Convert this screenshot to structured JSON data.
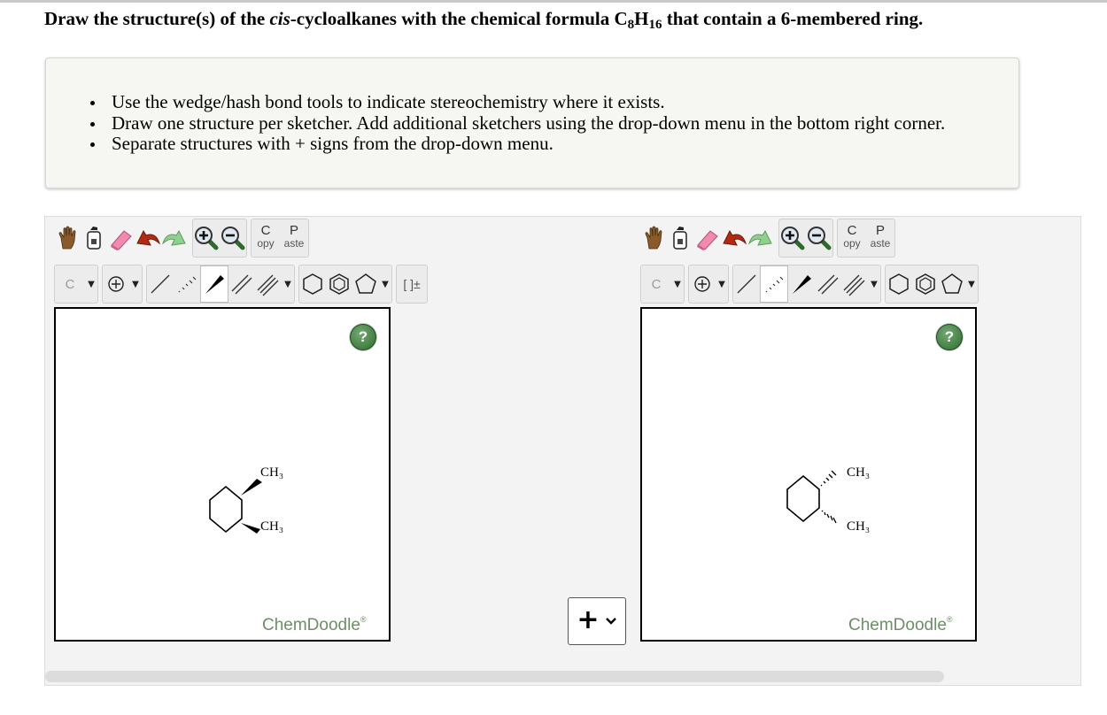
{
  "question": {
    "prefix": "Draw the structure(s) of the ",
    "italic": "cis",
    "middle": "-cycloalkanes with the chemical formula C",
    "sub1": "8",
    "h": "H",
    "sub2": "16",
    "suffix": " that contain a 6-membered ring."
  },
  "instructions": [
    "Use the wedge/hash bond tools to indicate stereochemistry where it exists.",
    "Draw one structure per sketcher. Add additional sketchers using the drop-down menu in the bottom right corner.",
    "Separate structures with + signs from the drop-down menu."
  ],
  "toolbar": {
    "copy_top": "C",
    "copy_bottom": "opy",
    "paste_top": "P",
    "paste_bottom": "aste",
    "element": "C",
    "charge_bracket": "[ ]±"
  },
  "sketchers": [
    {
      "help": "?",
      "label_top": "CH₃",
      "label_bottom": "CH₃",
      "brand": "ChemDoodle",
      "brand_mark": "®"
    },
    {
      "help": "?",
      "label_top": "CH₃",
      "label_bottom": "CH₃",
      "brand": "ChemDoodle",
      "brand_mark": "®"
    }
  ],
  "add_button": {
    "plus": "+",
    "chevron": "⌄"
  },
  "colors": {
    "brand": "#6d8e67",
    "help_green": "#2f6e2f",
    "undo_red": "#b22a12",
    "redo_green": "#7fc27f",
    "zoom_green": "#2d6b2d"
  }
}
